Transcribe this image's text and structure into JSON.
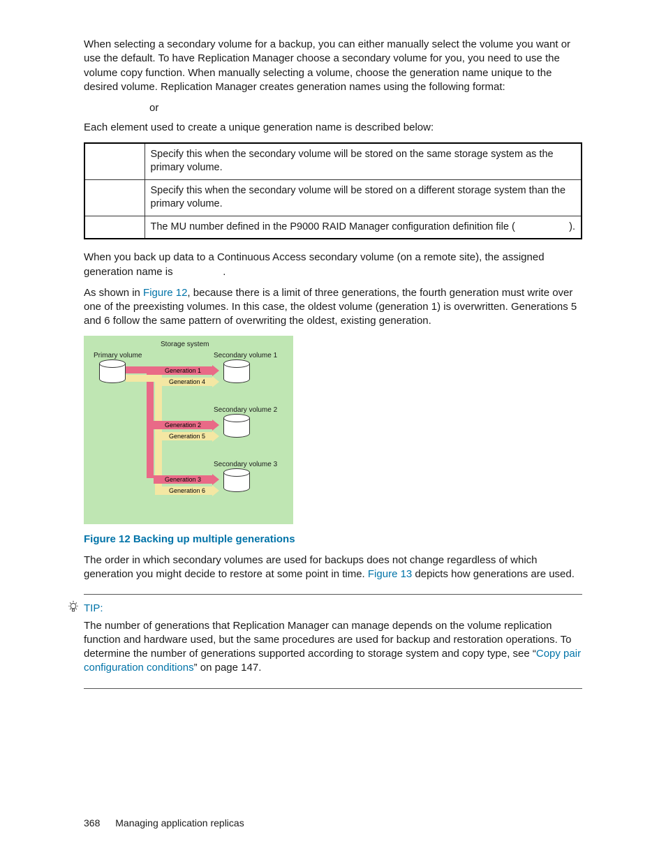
{
  "paragraphs": {
    "p1": "When selecting a secondary volume for a backup, you can either manually select the volume you want or use the default. To have Replication Manager choose a secondary volume for you, you need to use the volume copy function. When manually selecting a volume, choose the generation name unique to the desired volume. Replication Manager creates generation names using the following format:",
    "or": "or",
    "p2": "Each element used to create a unique generation name is described below:",
    "p3a": "When you back up data to a Continuous Access secondary volume (on a remote site), the assigned generation name is ",
    "p3b": ".",
    "p4a": "As shown in ",
    "p4link": "Figure 12",
    "p4b": ", because there is a limit of three generations, the fourth generation must write over one of the preexisting volumes. In this case, the oldest volume (generation 1) is overwritten. Generations 5 and 6 follow the same pattern of overwriting the oldest, existing generation.",
    "p5a": "The order in which secondary volumes are used for backups does not change regardless of which generation you might decide to restore at some point in time. ",
    "p5link": "Figure 13",
    "p5b": " depicts how generations are used."
  },
  "table": {
    "r1": "Specify this when the secondary volume will be stored on the same storage system as the primary volume.",
    "r2": "Specify this when the secondary volume will be stored on a different storage system than the primary volume.",
    "r3a": "The MU number defined in the P9000 RAID Manager configuration definition file (",
    "r3b": ")."
  },
  "figure_caption": "Figure 12 Backing up multiple generations",
  "tip": {
    "label": "TIP:",
    "body1": "The number of generations that Replication Manager can manage depends on the volume replication function and hardware used, but the same procedures are used for backup and restoration operations. To determine the number of generations supported according to storage system and copy type, see “",
    "link": "Copy pair configuration conditions",
    "body2": "” on page 147."
  },
  "footer": {
    "page": "368",
    "section": "Managing application replicas"
  },
  "diagram": {
    "storage_system": "Storage system",
    "primary": "Primary volume",
    "sv1": "Secondary volume 1",
    "sv2": "Secondary volume 2",
    "sv3": "Secondary volume 3",
    "g1": "Generation 1",
    "g2": "Generation 2",
    "g3": "Generation 3",
    "g4": "Generation 4",
    "g5": "Generation 5",
    "g6": "Generation 6"
  }
}
